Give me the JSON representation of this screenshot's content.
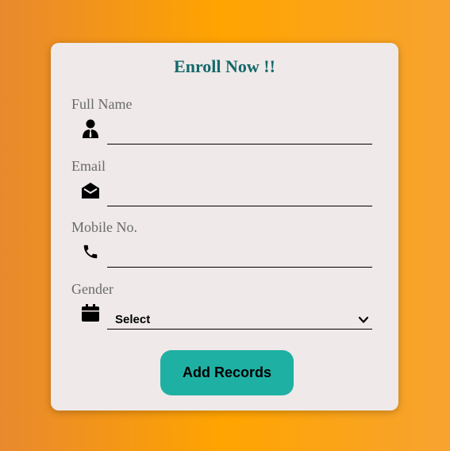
{
  "form": {
    "title": "Enroll Now !!",
    "fields": [
      {
        "label": "Full Name",
        "icon": "person-icon",
        "value": "",
        "placeholder": ""
      },
      {
        "label": "Email",
        "icon": "envelope-icon",
        "value": "",
        "placeholder": ""
      },
      {
        "label": "Mobile No.",
        "icon": "phone-icon",
        "value": "",
        "placeholder": ""
      }
    ],
    "gender": {
      "label": "Gender",
      "icon": "calendar-icon",
      "selected": "Select"
    },
    "submit_label": "Add Records"
  },
  "colors": {
    "background_gradient": [
      "#e8892e",
      "#ffa400",
      "#f7a331"
    ],
    "card": "#efe9e9",
    "title": "#16696a",
    "label": "#6a6a6a",
    "button": "#1fb0a4"
  }
}
